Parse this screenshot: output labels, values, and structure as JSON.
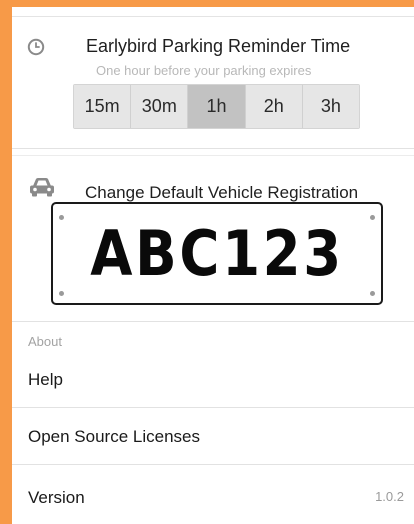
{
  "reminder": {
    "title": "Earlybird Parking Reminder Time",
    "subtitle": "One hour before your parking expires",
    "options": [
      "15m",
      "30m",
      "1h",
      "2h",
      "3h"
    ],
    "selected": "1h"
  },
  "vehicle": {
    "title": "Change Default Vehicle Registration",
    "plate": "ABC123"
  },
  "about": {
    "header": "About",
    "help_label": "Help",
    "licenses_label": "Open Source Licenses",
    "version_label": "Version",
    "version_value": "1.0.2"
  },
  "colors": {
    "accent_background": "#f79a48",
    "selected_segment": "#c2c2c2",
    "segment": "#e6e6e6"
  },
  "icons": {
    "reminder": "clock-icon",
    "vehicle": "car-icon"
  }
}
